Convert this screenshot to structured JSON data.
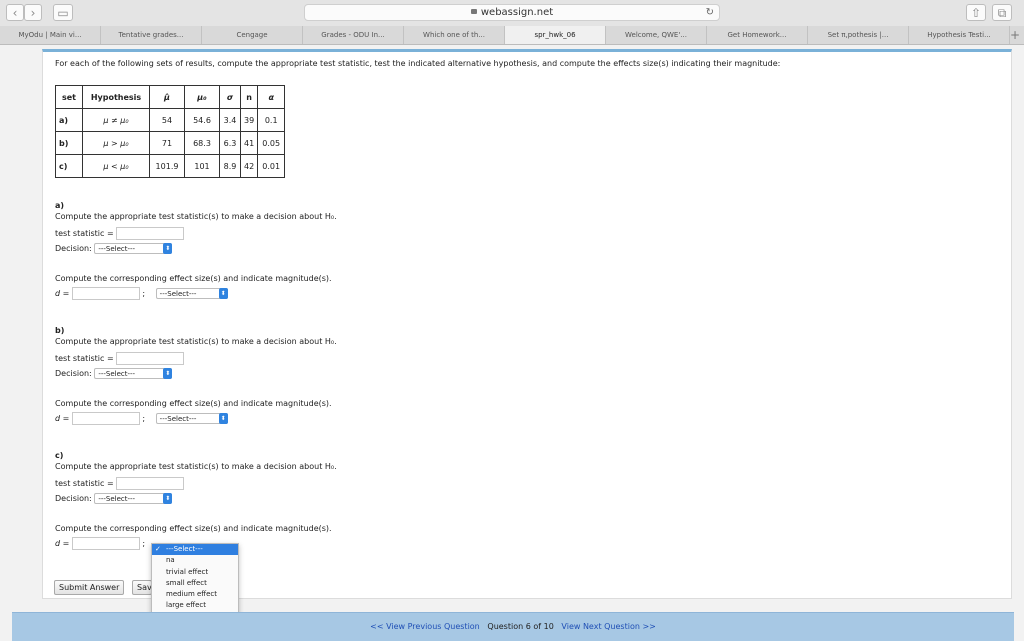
{
  "browser": {
    "url": "webassign.net",
    "tabs": [
      {
        "label": "MyOdu | Main vi..."
      },
      {
        "label": "Tentative grades..."
      },
      {
        "label": "Cengage"
      },
      {
        "label": "Grades - ODU In..."
      },
      {
        "label": "Which one of th..."
      },
      {
        "label": "spr_hwk_06"
      },
      {
        "label": "Welcome, QWE'..."
      },
      {
        "label": "Get Homework..."
      },
      {
        "label": "Set π,pothesis |..."
      },
      {
        "label": "Hypothesis Testi..."
      }
    ]
  },
  "question": {
    "intro": "For each of the following sets of results, compute the appropriate test statistic, test the indicated alternative hypothesis, and compute the effects size(s) indicating their magnitude:",
    "table": {
      "headers": [
        "set",
        "Hypothesis",
        "μ̂",
        "μ₀",
        "σ",
        "n",
        "α"
      ],
      "rows": [
        {
          "set": "a)",
          "hyp": "μ ≠ μ₀",
          "muhat": "54",
          "mu0": "54.6",
          "sigma": "3.4",
          "n": "39",
          "alpha": "0.1"
        },
        {
          "set": "b)",
          "hyp": "μ > μ₀",
          "muhat": "71",
          "mu0": "68.3",
          "sigma": "6.3",
          "n": "41",
          "alpha": "0.05"
        },
        {
          "set": "c)",
          "hyp": "μ < μ₀",
          "muhat": "101.9",
          "mu0": "101",
          "sigma": "8.9",
          "n": "42",
          "alpha": "0.01"
        }
      ]
    },
    "parts": [
      {
        "label": "a)",
        "compute_stat": "Compute the appropriate test statistic(s) to make a decision about H₀.",
        "stat_label": "test statistic =",
        "decision_label": "Decision:",
        "select": "---Select---",
        "compute_effect": "Compute the corresponding effect size(s) and indicate magnitude(s).",
        "d_label": "d =",
        "semi": ";"
      },
      {
        "label": "b)",
        "compute_stat": "Compute the appropriate test statistic(s) to make a decision about H₀.",
        "stat_label": "test statistic =",
        "decision_label": "Decision:",
        "select": "---Select---",
        "compute_effect": "Compute the corresponding effect size(s) and indicate magnitude(s).",
        "d_label": "d =",
        "semi": ";"
      },
      {
        "label": "c)",
        "compute_stat": "Compute the appropriate test statistic(s) to make a decision about H₀.",
        "stat_label": "test statistic =",
        "decision_label": "Decision:",
        "select": "---Select---",
        "compute_effect": "Compute the corresponding effect size(s) and indicate magnitude(s).",
        "d_label": "d =",
        "semi": ";"
      }
    ],
    "dropdown": {
      "options": [
        "---Select---",
        "na",
        "trivial effect",
        "small effect",
        "medium effect",
        "large effect"
      ]
    },
    "buttons": {
      "submit": "Submit Answer",
      "save": "Sav"
    }
  },
  "footer": {
    "prev": "<< View Previous Question",
    "status": "Question 6 of 10",
    "next": "View Next Question >>"
  },
  "colors": {
    "accent": "#2f83e0",
    "footer_bg": "#a7c8e4"
  }
}
